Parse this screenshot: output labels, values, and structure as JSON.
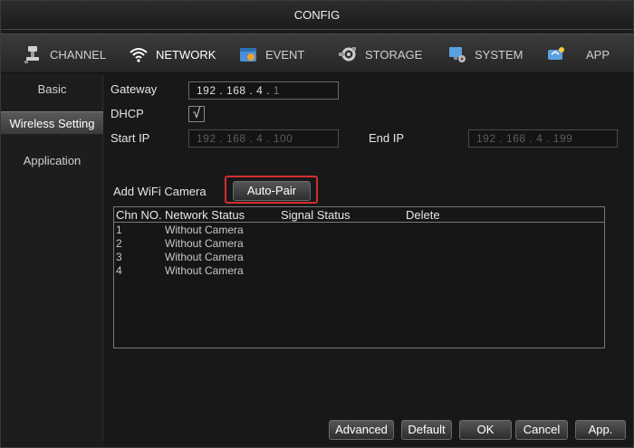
{
  "window": {
    "title": "CONFIG"
  },
  "tabs": [
    {
      "label": "CHANNEL",
      "icon": "channel-icon"
    },
    {
      "label": "NETWORK",
      "icon": "wifi-icon",
      "active": true
    },
    {
      "label": "EVENT",
      "icon": "event-icon"
    },
    {
      "label": "STORAGE",
      "icon": "storage-icon"
    },
    {
      "label": "SYSTEM",
      "icon": "system-icon"
    },
    {
      "label": "APP",
      "icon": "app-icon"
    }
  ],
  "sidebar": {
    "items": [
      {
        "label": "Basic"
      },
      {
        "label": "Wireless Setting",
        "active": true
      },
      {
        "label": "Application"
      }
    ]
  },
  "form": {
    "gateway_label": "Gateway",
    "gateway": [
      "192",
      "168",
      "4",
      "1"
    ],
    "dhcp_label": "DHCP",
    "dhcp_checked": "√",
    "start_ip_label": "Start IP",
    "start_ip": [
      "192",
      "168",
      "4",
      "100"
    ],
    "end_ip_label": "End IP",
    "end_ip": [
      "192",
      "168",
      "4",
      "199"
    ],
    "add_camera_label": "Add WiFi Camera",
    "auto_pair_label": "Auto-Pair"
  },
  "table": {
    "headers": [
      "Chn NO.",
      "Network Status",
      "Signal Status",
      "Delete"
    ],
    "rows": [
      {
        "chn": "1",
        "status": "Without Camera"
      },
      {
        "chn": "2",
        "status": "Without Camera"
      },
      {
        "chn": "3",
        "status": "Without Camera"
      },
      {
        "chn": "4",
        "status": "Without Camera"
      }
    ]
  },
  "footer": {
    "advanced": "Advanced",
    "default": "Default",
    "ok": "OK",
    "cancel": "Cancel",
    "apply": "App."
  },
  "colors": {
    "highlight": "#d32f2f",
    "background": "#1b1b1b"
  }
}
